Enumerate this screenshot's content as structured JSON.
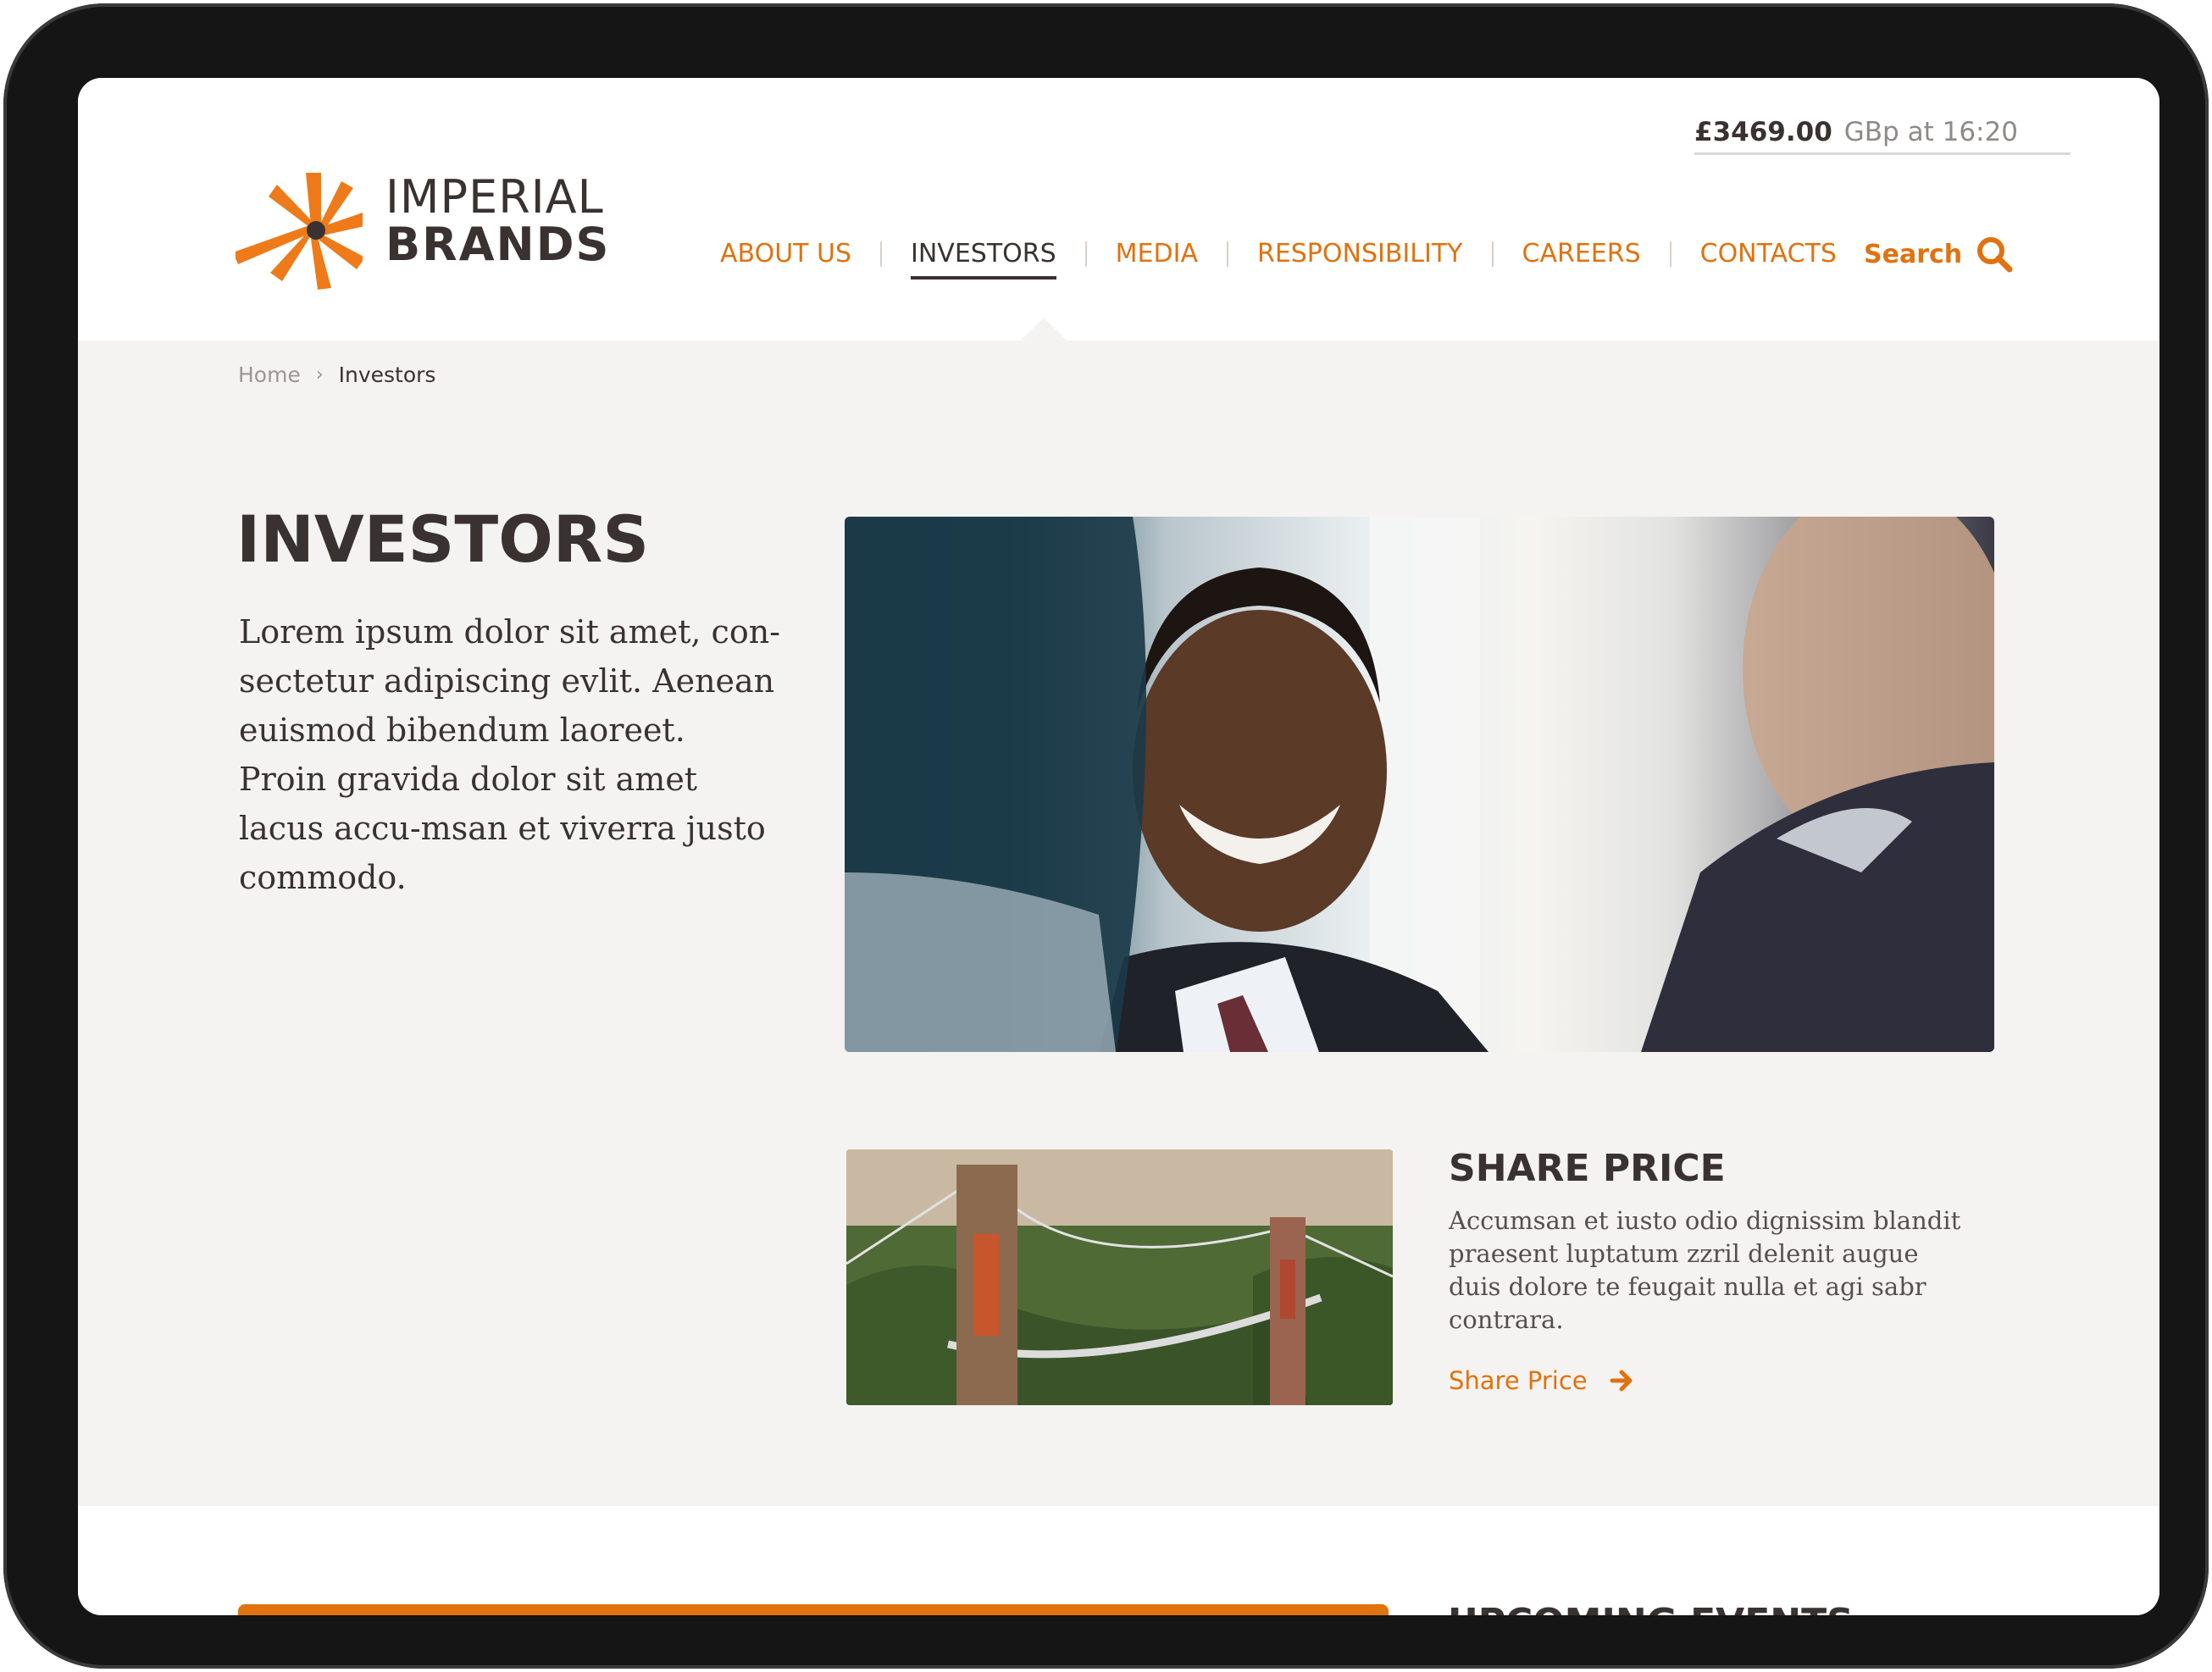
{
  "ticker": {
    "price": "£3469.00",
    "label": "GBp at 16:20"
  },
  "logo": {
    "line1": "IMPERIAL",
    "line2": "BRANDS"
  },
  "nav": {
    "items": [
      {
        "label": "ABOUT US"
      },
      {
        "label": "INVESTORS"
      },
      {
        "label": "MEDIA"
      },
      {
        "label": "RESPONSIBILITY"
      },
      {
        "label": "CAREERS"
      },
      {
        "label": "CONTACTS"
      }
    ],
    "active": "INVESTORS",
    "search_label": "Search"
  },
  "breadcrumb": {
    "home": "Home",
    "separator": "›",
    "current": "Investors"
  },
  "page": {
    "title": "INVESTORS",
    "intro": "Lorem ipsum dolor sit amet, con-sectetur adipiscing evlit. Aenean euismod bibendum laoreet. Proin gravida dolor sit amet lacus accu-msan et viverra justo commodo."
  },
  "share_price": {
    "title": "SHARE PRICE",
    "text": "Accumsan et iusto odio dignissim blandit praesent luptatum zzril delenit augue duis dolore te feugait nulla et agi sabr contrara.",
    "link_label": "Share Price"
  },
  "events": {
    "title": "UPCOMING EVENTS"
  },
  "colors": {
    "accent": "#e0720f",
    "text_dark": "#3a3230",
    "background": "#f5f3f1",
    "device_frame": "#151515"
  },
  "icons": {
    "logo": "imperial-starburst-icon",
    "search": "search-icon",
    "link_arrow": "arrow-right-icon"
  }
}
